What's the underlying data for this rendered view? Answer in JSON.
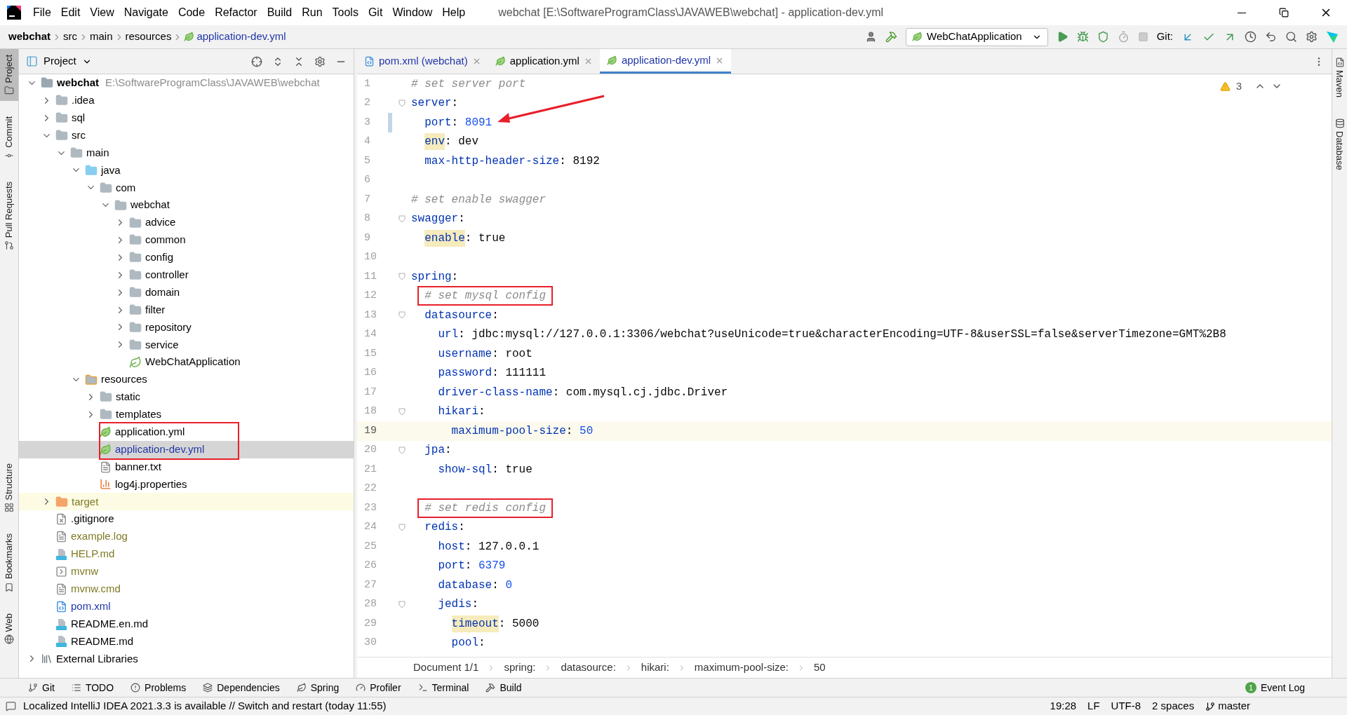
{
  "menu": [
    "File",
    "Edit",
    "View",
    "Navigate",
    "Code",
    "Refactor",
    "Build",
    "Run",
    "Tools",
    "Git",
    "Window",
    "Help"
  ],
  "window_title": "webchat [E:\\SoftwareProgramClass\\JAVAWEB\\webchat] - application-dev.yml",
  "breadcrumbs": [
    {
      "label": "webchat",
      "kind": "project"
    },
    {
      "label": "src",
      "kind": "folder"
    },
    {
      "label": "main",
      "kind": "folder"
    },
    {
      "label": "resources",
      "kind": "folder"
    },
    {
      "label": "application-dev.yml",
      "kind": "yml"
    }
  ],
  "toolbar": {
    "run_config": "WebChatApplication",
    "git_label": "Git:"
  },
  "left_strip": {
    "top": [
      {
        "label": "Project",
        "kind": "project",
        "selected": true
      },
      {
        "label": "Commit",
        "kind": "commit",
        "selected": false
      },
      {
        "label": "Pull Requests",
        "kind": "pull",
        "selected": false
      }
    ],
    "bottom": [
      {
        "label": "Structure",
        "kind": "structure",
        "selected": false
      },
      {
        "label": "Bookmarks",
        "kind": "bookmark",
        "selected": false
      },
      {
        "label": "Web",
        "kind": "web",
        "selected": false
      }
    ]
  },
  "right_strip": [
    {
      "label": "Maven",
      "kind": "maven"
    },
    {
      "label": "Database",
      "kind": "database"
    }
  ],
  "project_panel": {
    "title": "Project",
    "tree": [
      {
        "label": "webchat",
        "kind": "project",
        "note": "E:\\SoftwareProgramClass\\JAVAWEB\\webchat",
        "expanded": true,
        "selected": false,
        "color": "#000000",
        "children": [
          {
            "label": ".idea",
            "kind": "folder",
            "expanded": false,
            "selected": false,
            "color": "#000000"
          },
          {
            "label": "sql",
            "kind": "folder",
            "expanded": false,
            "selected": false,
            "color": "#000000"
          },
          {
            "label": "src",
            "kind": "folder",
            "expanded": true,
            "selected": false,
            "color": "#000000",
            "children": [
              {
                "label": "main",
                "kind": "folder",
                "expanded": true,
                "selected": false,
                "color": "#000000",
                "children": [
                  {
                    "label": "java",
                    "kind": "source_folder",
                    "expanded": true,
                    "selected": false,
                    "color": "#000000",
                    "children": [
                      {
                        "label": "com",
                        "kind": "package",
                        "expanded": true,
                        "selected": false,
                        "color": "#000000",
                        "children": [
                          {
                            "label": "webchat",
                            "kind": "package",
                            "expanded": true,
                            "selected": false,
                            "color": "#000000",
                            "children": [
                              {
                                "label": "advice",
                                "kind": "package",
                                "expanded": false,
                                "selected": false,
                                "color": "#000000"
                              },
                              {
                                "label": "common",
                                "kind": "package",
                                "expanded": false,
                                "selected": false,
                                "color": "#000000"
                              },
                              {
                                "label": "config",
                                "kind": "package",
                                "expanded": false,
                                "selected": false,
                                "color": "#000000"
                              },
                              {
                                "label": "controller",
                                "kind": "package",
                                "expanded": false,
                                "selected": false,
                                "color": "#000000"
                              },
                              {
                                "label": "domain",
                                "kind": "package",
                                "expanded": false,
                                "selected": false,
                                "color": "#000000"
                              },
                              {
                                "label": "filter",
                                "kind": "package",
                                "expanded": false,
                                "selected": false,
                                "color": "#000000"
                              },
                              {
                                "label": "repository",
                                "kind": "package",
                                "expanded": false,
                                "selected": false,
                                "color": "#000000"
                              },
                              {
                                "label": "service",
                                "kind": "package",
                                "expanded": false,
                                "selected": false,
                                "color": "#000000"
                              },
                              {
                                "label": "WebChatApplication",
                                "kind": "spring_class",
                                "selected": false,
                                "color": "#000000"
                              }
                            ]
                          }
                        ]
                      }
                    ]
                  },
                  {
                    "label": "resources",
                    "kind": "resource_folder",
                    "expanded": true,
                    "selected": false,
                    "color": "#000000",
                    "children": [
                      {
                        "label": "static",
                        "kind": "folder",
                        "expanded": false,
                        "selected": false,
                        "color": "#000000",
                        "annotated": false
                      },
                      {
                        "label": "templates",
                        "kind": "folder",
                        "expanded": false,
                        "selected": false,
                        "color": "#000000",
                        "annotated": false
                      },
                      {
                        "label": "application.yml",
                        "kind": "yml",
                        "selected": false,
                        "color": "#000000",
                        "annotated": true
                      },
                      {
                        "label": "application-dev.yml",
                        "kind": "yml",
                        "selected": true,
                        "color": "#2136a8",
                        "annotated": true
                      },
                      {
                        "label": "banner.txt",
                        "kind": "text",
                        "selected": false,
                        "color": "#000000",
                        "annotated": false
                      },
                      {
                        "label": "log4j.properties",
                        "kind": "properties",
                        "selected": false,
                        "color": "#000000",
                        "annotated": false
                      }
                    ]
                  }
                ]
              }
            ]
          },
          {
            "label": "target",
            "kind": "excluded",
            "expanded": false,
            "selected": false,
            "color": "#7f7a24"
          },
          {
            "label": ".gitignore",
            "kind": "gitignore",
            "selected": false,
            "color": "#000000"
          },
          {
            "label": "example.log",
            "kind": "text",
            "selected": false,
            "color": "#7f7a24"
          },
          {
            "label": "HELP.md",
            "kind": "markdown",
            "selected": false,
            "color": "#7f7a24"
          },
          {
            "label": "mvnw",
            "kind": "script",
            "selected": false,
            "color": "#7f7a24"
          },
          {
            "label": "mvnw.cmd",
            "kind": "text",
            "selected": false,
            "color": "#7f7a24"
          },
          {
            "label": "pom.xml",
            "kind": "maven",
            "selected": false,
            "color": "#2136a8"
          },
          {
            "label": "README.en.md",
            "kind": "markdown",
            "selected": false,
            "color": "#000000"
          },
          {
            "label": "README.md",
            "kind": "markdown",
            "selected": false,
            "color": "#000000"
          }
        ]
      },
      {
        "label": "External Libraries",
        "kind": "libraries",
        "expanded": false,
        "selected": false,
        "color": "#000000"
      }
    ]
  },
  "editor_tabs": [
    {
      "label": "pom.xml (webchat)",
      "kind": "maven",
      "selected": false
    },
    {
      "label": "application.yml",
      "kind": "yml",
      "selected": false
    },
    {
      "label": "application-dev.yml",
      "kind": "yml",
      "selected": true
    }
  ],
  "editor": {
    "warnings": "3",
    "line_numbers": [
      {
        "number": "1",
        "current": false,
        "changed": false
      },
      {
        "number": "2",
        "current": false,
        "changed": false
      },
      {
        "number": "3",
        "current": false,
        "changed": true
      },
      {
        "number": "4",
        "current": false,
        "changed": false
      },
      {
        "number": "5",
        "current": false,
        "changed": false
      },
      {
        "number": "6",
        "current": false,
        "changed": false
      },
      {
        "number": "7",
        "current": false,
        "changed": false
      },
      {
        "number": "8",
        "current": false,
        "changed": false
      },
      {
        "number": "9",
        "current": false,
        "changed": false
      },
      {
        "number": "10",
        "current": false,
        "changed": false
      },
      {
        "number": "11",
        "current": false,
        "changed": false
      },
      {
        "number": "12",
        "current": false,
        "changed": false
      },
      {
        "number": "13",
        "current": false,
        "changed": false
      },
      {
        "number": "14",
        "current": false,
        "changed": false
      },
      {
        "number": "15",
        "current": false,
        "changed": false
      },
      {
        "number": "16",
        "current": false,
        "changed": false
      },
      {
        "number": "17",
        "current": false,
        "changed": false
      },
      {
        "number": "18",
        "current": false,
        "changed": false
      },
      {
        "number": "19",
        "current": true,
        "changed": false
      },
      {
        "number": "20",
        "current": false,
        "changed": false
      },
      {
        "number": "21",
        "current": false,
        "changed": false
      },
      {
        "number": "22",
        "current": false,
        "changed": false
      },
      {
        "number": "23",
        "current": false,
        "changed": false
      },
      {
        "number": "24",
        "current": false,
        "changed": false
      },
      {
        "number": "25",
        "current": false,
        "changed": false
      },
      {
        "number": "26",
        "current": false,
        "changed": false
      },
      {
        "number": "27",
        "current": false,
        "changed": false
      },
      {
        "number": "28",
        "current": false,
        "changed": false
      },
      {
        "number": "29",
        "current": false,
        "changed": false
      },
      {
        "number": "30",
        "current": false,
        "changed": false
      }
    ],
    "code": [
      {
        "kind": "comment",
        "text": "# set server port",
        "annotated": false
      },
      {
        "kind": "entry",
        "key": "server",
        "sep": ":",
        "children": [
          {
            "kind": "entry",
            "key": "port",
            "sep": ":",
            "value": "8091",
            "color": "#1750eb",
            "warning": false,
            "annotated": true
          },
          {
            "kind": "entry",
            "key": "env",
            "sep": ":",
            "value": "dev",
            "color": "#080808",
            "warning": true,
            "annotated": false
          },
          {
            "kind": "entry",
            "key": "max-http-header-size",
            "sep": ":",
            "value": "8192",
            "color": "#080808",
            "warning": false,
            "annotated": false
          }
        ]
      },
      {
        "kind": "blank"
      },
      {
        "kind": "comment",
        "text": "# set enable swagger",
        "annotated": false
      },
      {
        "kind": "entry",
        "key": "swagger",
        "sep": ":",
        "children": [
          {
            "kind": "entry",
            "key": "enable",
            "sep": ":",
            "value": "true",
            "color": "#080808",
            "warning": true,
            "annotated": false
          }
        ]
      },
      {
        "kind": "blank"
      },
      {
        "kind": "entry",
        "key": "spring",
        "sep": ":",
        "children": [
          {
            "kind": "comment",
            "text": "# set mysql config",
            "annotated": true
          },
          {
            "kind": "entry",
            "key": "datasource",
            "sep": ":",
            "children": [
              {
                "kind": "entry",
                "key": "url",
                "sep": ":",
                "value": "jdbc:mysql://127.0.0.1:3306/webchat?useUnicode=true&characterEncoding=UTF-8&userSSL=false&serverTimezone=GMT%2B8",
                "color": "#080808",
                "warning": false,
                "annotated": false
              },
              {
                "kind": "entry",
                "key": "username",
                "sep": ":",
                "value": "root",
                "color": "#080808",
                "warning": false,
                "annotated": false
              },
              {
                "kind": "entry",
                "key": "password",
                "sep": ":",
                "value": "111111",
                "color": "#080808",
                "warning": false,
                "annotated": false
              },
              {
                "kind": "entry",
                "key": "driver-class-name",
                "sep": ":",
                "value": "com.mysql.cj.jdbc.Driver",
                "color": "#080808",
                "warning": false,
                "annotated": false
              },
              {
                "kind": "entry",
                "key": "hikari",
                "sep": ":",
                "children": [
                  {
                    "kind": "entry",
                    "key": "maximum-pool-size",
                    "sep": ":",
                    "value": "50",
                    "color": "#1750eb",
                    "warning": false,
                    "annotated": false
                  }
                ]
              }
            ]
          },
          {
            "kind": "entry",
            "key": "jpa",
            "sep": ":",
            "children": [
              {
                "kind": "entry",
                "key": "show-sql",
                "sep": ":",
                "value": "true",
                "color": "#080808",
                "warning": false,
                "annotated": false
              }
            ]
          },
          {
            "kind": "blank"
          },
          {
            "kind": "comment",
            "text": "# set redis config",
            "annotated": true
          },
          {
            "kind": "entry",
            "key": "redis",
            "sep": ":",
            "children": [
              {
                "kind": "entry",
                "key": "host",
                "sep": ":",
                "value": "127.0.0.1",
                "color": "#080808",
                "warning": false,
                "annotated": false
              },
              {
                "kind": "entry",
                "key": "port",
                "sep": ":",
                "value": "6379",
                "color": "#1750eb",
                "warning": false,
                "annotated": false
              },
              {
                "kind": "entry",
                "key": "database",
                "sep": ":",
                "value": "0",
                "color": "#1750eb",
                "warning": false,
                "annotated": false
              },
              {
                "kind": "entry",
                "key": "jedis",
                "sep": ":",
                "children": [
                  {
                    "kind": "entry",
                    "key": "timeout",
                    "sep": ":",
                    "value": "5000",
                    "color": "#080808",
                    "warning": true,
                    "annotated": false
                  },
                  {
                    "kind": "entry",
                    "key": "pool",
                    "sep": ":"
                  }
                ]
              }
            ]
          }
        ]
      }
    ]
  },
  "editor_breadcrumbs": [
    "Document 1/1",
    "spring:",
    "datasource:",
    "hikari:",
    "maximum-pool-size:",
    "50"
  ],
  "tool_windows": [
    {
      "label": "Git",
      "kind": "git"
    },
    {
      "label": "TODO",
      "kind": "todo"
    },
    {
      "label": "Problems",
      "kind": "problems"
    },
    {
      "label": "Dependencies",
      "kind": "dependencies"
    },
    {
      "label": "Spring",
      "kind": "spring"
    },
    {
      "label": "Profiler",
      "kind": "profiler"
    },
    {
      "label": "Terminal",
      "kind": "terminal"
    },
    {
      "label": "Build",
      "kind": "build"
    }
  ],
  "event_log": {
    "label": "Event Log",
    "count": "1"
  },
  "status_bar": {
    "message": "Localized IntelliJ IDEA 2021.3.3 is available // Switch and restart (today 11:55)",
    "position": "19:28",
    "line_separator": "LF",
    "encoding": "UTF-8",
    "indent": "2 spaces",
    "branch": "master"
  }
}
